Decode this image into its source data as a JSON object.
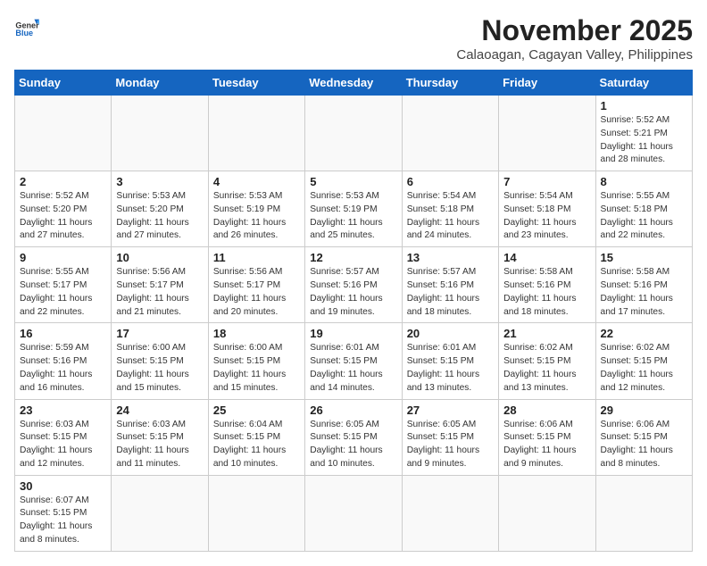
{
  "header": {
    "logo_general": "General",
    "logo_blue": "Blue",
    "month": "November 2025",
    "location": "Calaoagan, Cagayan Valley, Philippines"
  },
  "weekdays": [
    "Sunday",
    "Monday",
    "Tuesday",
    "Wednesday",
    "Thursday",
    "Friday",
    "Saturday"
  ],
  "weeks": [
    [
      {
        "day": "",
        "content": ""
      },
      {
        "day": "",
        "content": ""
      },
      {
        "day": "",
        "content": ""
      },
      {
        "day": "",
        "content": ""
      },
      {
        "day": "",
        "content": ""
      },
      {
        "day": "",
        "content": ""
      },
      {
        "day": "1",
        "content": "Sunrise: 5:52 AM\nSunset: 5:21 PM\nDaylight: 11 hours\nand 28 minutes."
      }
    ],
    [
      {
        "day": "2",
        "content": "Sunrise: 5:52 AM\nSunset: 5:20 PM\nDaylight: 11 hours\nand 27 minutes."
      },
      {
        "day": "3",
        "content": "Sunrise: 5:53 AM\nSunset: 5:20 PM\nDaylight: 11 hours\nand 27 minutes."
      },
      {
        "day": "4",
        "content": "Sunrise: 5:53 AM\nSunset: 5:19 PM\nDaylight: 11 hours\nand 26 minutes."
      },
      {
        "day": "5",
        "content": "Sunrise: 5:53 AM\nSunset: 5:19 PM\nDaylight: 11 hours\nand 25 minutes."
      },
      {
        "day": "6",
        "content": "Sunrise: 5:54 AM\nSunset: 5:18 PM\nDaylight: 11 hours\nand 24 minutes."
      },
      {
        "day": "7",
        "content": "Sunrise: 5:54 AM\nSunset: 5:18 PM\nDaylight: 11 hours\nand 23 minutes."
      },
      {
        "day": "8",
        "content": "Sunrise: 5:55 AM\nSunset: 5:18 PM\nDaylight: 11 hours\nand 22 minutes."
      }
    ],
    [
      {
        "day": "9",
        "content": "Sunrise: 5:55 AM\nSunset: 5:17 PM\nDaylight: 11 hours\nand 22 minutes."
      },
      {
        "day": "10",
        "content": "Sunrise: 5:56 AM\nSunset: 5:17 PM\nDaylight: 11 hours\nand 21 minutes."
      },
      {
        "day": "11",
        "content": "Sunrise: 5:56 AM\nSunset: 5:17 PM\nDaylight: 11 hours\nand 20 minutes."
      },
      {
        "day": "12",
        "content": "Sunrise: 5:57 AM\nSunset: 5:16 PM\nDaylight: 11 hours\nand 19 minutes."
      },
      {
        "day": "13",
        "content": "Sunrise: 5:57 AM\nSunset: 5:16 PM\nDaylight: 11 hours\nand 18 minutes."
      },
      {
        "day": "14",
        "content": "Sunrise: 5:58 AM\nSunset: 5:16 PM\nDaylight: 11 hours\nand 18 minutes."
      },
      {
        "day": "15",
        "content": "Sunrise: 5:58 AM\nSunset: 5:16 PM\nDaylight: 11 hours\nand 17 minutes."
      }
    ],
    [
      {
        "day": "16",
        "content": "Sunrise: 5:59 AM\nSunset: 5:16 PM\nDaylight: 11 hours\nand 16 minutes."
      },
      {
        "day": "17",
        "content": "Sunrise: 6:00 AM\nSunset: 5:15 PM\nDaylight: 11 hours\nand 15 minutes."
      },
      {
        "day": "18",
        "content": "Sunrise: 6:00 AM\nSunset: 5:15 PM\nDaylight: 11 hours\nand 15 minutes."
      },
      {
        "day": "19",
        "content": "Sunrise: 6:01 AM\nSunset: 5:15 PM\nDaylight: 11 hours\nand 14 minutes."
      },
      {
        "day": "20",
        "content": "Sunrise: 6:01 AM\nSunset: 5:15 PM\nDaylight: 11 hours\nand 13 minutes."
      },
      {
        "day": "21",
        "content": "Sunrise: 6:02 AM\nSunset: 5:15 PM\nDaylight: 11 hours\nand 13 minutes."
      },
      {
        "day": "22",
        "content": "Sunrise: 6:02 AM\nSunset: 5:15 PM\nDaylight: 11 hours\nand 12 minutes."
      }
    ],
    [
      {
        "day": "23",
        "content": "Sunrise: 6:03 AM\nSunset: 5:15 PM\nDaylight: 11 hours\nand 12 minutes."
      },
      {
        "day": "24",
        "content": "Sunrise: 6:03 AM\nSunset: 5:15 PM\nDaylight: 11 hours\nand 11 minutes."
      },
      {
        "day": "25",
        "content": "Sunrise: 6:04 AM\nSunset: 5:15 PM\nDaylight: 11 hours\nand 10 minutes."
      },
      {
        "day": "26",
        "content": "Sunrise: 6:05 AM\nSunset: 5:15 PM\nDaylight: 11 hours\nand 10 minutes."
      },
      {
        "day": "27",
        "content": "Sunrise: 6:05 AM\nSunset: 5:15 PM\nDaylight: 11 hours\nand 9 minutes."
      },
      {
        "day": "28",
        "content": "Sunrise: 6:06 AM\nSunset: 5:15 PM\nDaylight: 11 hours\nand 9 minutes."
      },
      {
        "day": "29",
        "content": "Sunrise: 6:06 AM\nSunset: 5:15 PM\nDaylight: 11 hours\nand 8 minutes."
      }
    ],
    [
      {
        "day": "30",
        "content": "Sunrise: 6:07 AM\nSunset: 5:15 PM\nDaylight: 11 hours\nand 8 minutes."
      },
      {
        "day": "",
        "content": ""
      },
      {
        "day": "",
        "content": ""
      },
      {
        "day": "",
        "content": ""
      },
      {
        "day": "",
        "content": ""
      },
      {
        "day": "",
        "content": ""
      },
      {
        "day": "",
        "content": ""
      }
    ]
  ]
}
